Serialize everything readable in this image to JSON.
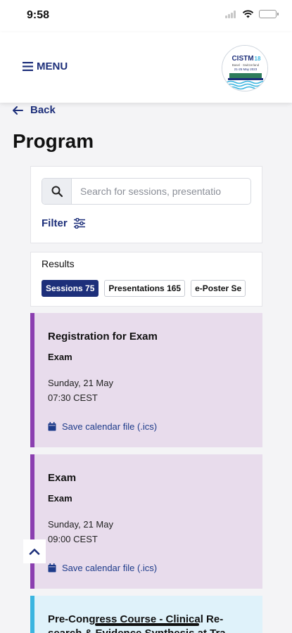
{
  "status": {
    "time": "9:58"
  },
  "header": {
    "menu_label": "MENU",
    "logo": {
      "name": "CISTM18",
      "subtitle": "Basel · Switzerland",
      "dates": "21-25 May 2023"
    }
  },
  "nav": {
    "back_label": "Back"
  },
  "page": {
    "title": "Program"
  },
  "search": {
    "placeholder": "Search for sessions, presentatio",
    "value": ""
  },
  "filter": {
    "label": "Filter"
  },
  "results": {
    "label": "Results",
    "chips": [
      {
        "label": "Sessions 75",
        "active": true
      },
      {
        "label": "Presentations 165",
        "active": false
      },
      {
        "label": "e-Poster Se",
        "active": false
      }
    ]
  },
  "sessions": [
    {
      "title": "Registration for Exam",
      "subtitle": "Exam",
      "day": "Sunday, 21 May",
      "time": "07:30 CEST",
      "calendar_label": "Save calendar file (.ics)",
      "accent": "#8b3fb0"
    },
    {
      "title": "Exam",
      "subtitle": "Exam",
      "day": "Sunday, 21 May",
      "time": "09:00 CEST",
      "calendar_label": "Save calendar file (.ics)",
      "accent": "#8b3fb0"
    },
    {
      "title": "Pre-Congress Course - Clinical Re-search & Evidence Synthesis at Tra",
      "accent": "#3ab5e0"
    }
  ],
  "colors": {
    "brand": "#1d2f7a",
    "session_purple_bg": "#e8dcec",
    "session_blue_bg": "#dff2fa"
  }
}
